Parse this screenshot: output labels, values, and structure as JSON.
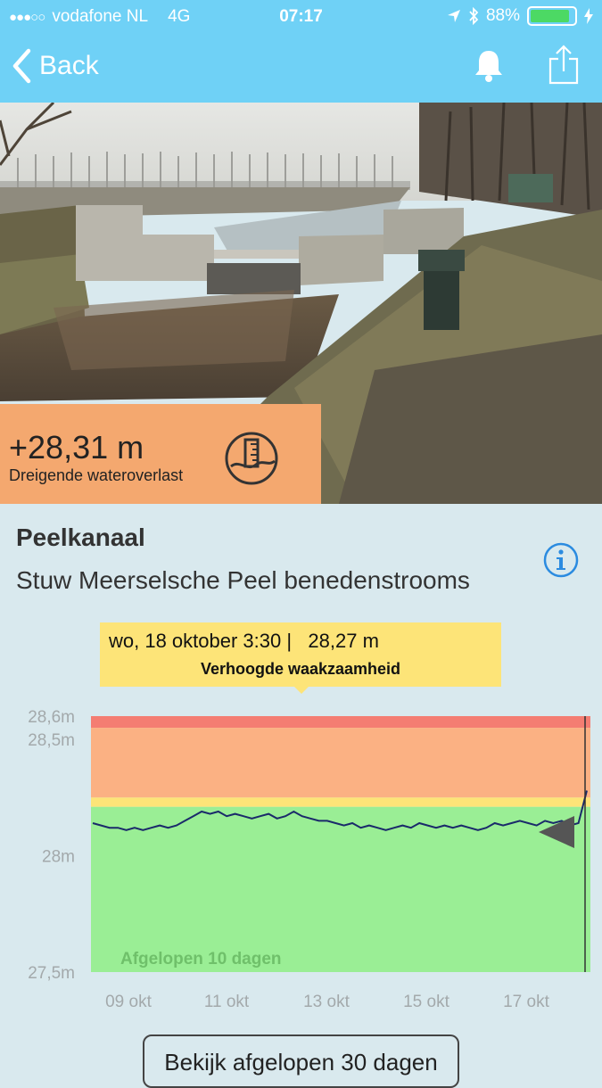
{
  "status_bar": {
    "carrier": "vodafone NL",
    "network": "4G",
    "time": "07:17",
    "battery": "88%",
    "battery_level": 0.88,
    "signal_dots_filled": 3,
    "signal_dots_total": 5
  },
  "nav": {
    "back_label": "Back",
    "icons": [
      "bell-icon",
      "share-icon"
    ]
  },
  "level": {
    "value": "+28,31 m",
    "status": "Dreigende wateroverlast",
    "icon": "water-gauge-icon",
    "color": "#f4a86f"
  },
  "location": {
    "title": "Peelkanaal",
    "subtitle": "Stuw Meerselsche Peel benedenstrooms"
  },
  "tooltip": {
    "line1": "wo, 18 oktober 3:30 |   28,27 m",
    "line2": "Verhoogde waakzaamheid",
    "color": "#fde478"
  },
  "chart_data": {
    "type": "line",
    "period_label": "Afgelopen 10 dagen",
    "ylim": [
      27.5,
      28.6
    ],
    "y_ticks": [
      {
        "value": 28.6,
        "label": "28,6m"
      },
      {
        "value": 28.5,
        "label": "28,5m"
      },
      {
        "value": 28.0,
        "label": "28m"
      },
      {
        "value": 27.5,
        "label": "27,5m"
      }
    ],
    "x_ticks": [
      "09 okt",
      "11 okt",
      "13 okt",
      "15 okt",
      "17 okt"
    ],
    "bands": [
      {
        "from": 28.55,
        "to": 28.6,
        "color": "#f47d72"
      },
      {
        "from": 28.25,
        "to": 28.55,
        "color": "#fbb183"
      },
      {
        "from": 28.21,
        "to": 28.25,
        "color": "#fde478"
      },
      {
        "from": 27.5,
        "to": 28.21,
        "color": "#9aee95"
      }
    ],
    "series": [
      {
        "values": [
          28.14,
          28.13,
          28.12,
          28.12,
          28.11,
          28.12,
          28.11,
          28.12,
          28.13,
          28.12,
          28.13,
          28.15,
          28.17,
          28.19,
          28.18,
          28.19,
          28.17,
          28.18,
          28.17,
          28.16,
          28.17,
          28.18,
          28.16,
          28.17,
          28.19,
          28.17,
          28.16,
          28.15,
          28.15,
          28.14,
          28.13,
          28.14,
          28.12,
          28.13,
          28.12,
          28.11,
          28.12,
          28.13,
          28.12,
          28.14,
          28.13,
          28.12,
          28.13,
          28.12,
          28.13,
          28.12,
          28.11,
          28.12,
          28.14,
          28.13,
          28.14,
          28.15,
          28.14,
          28.13,
          28.15,
          28.14,
          28.15,
          28.13,
          28.14,
          28.28
        ],
        "color": "#1a2a6a"
      }
    ],
    "current_marker": "arrow-marker-icon"
  },
  "more_button": {
    "label": "Bekijk afgelopen 30 dagen"
  }
}
